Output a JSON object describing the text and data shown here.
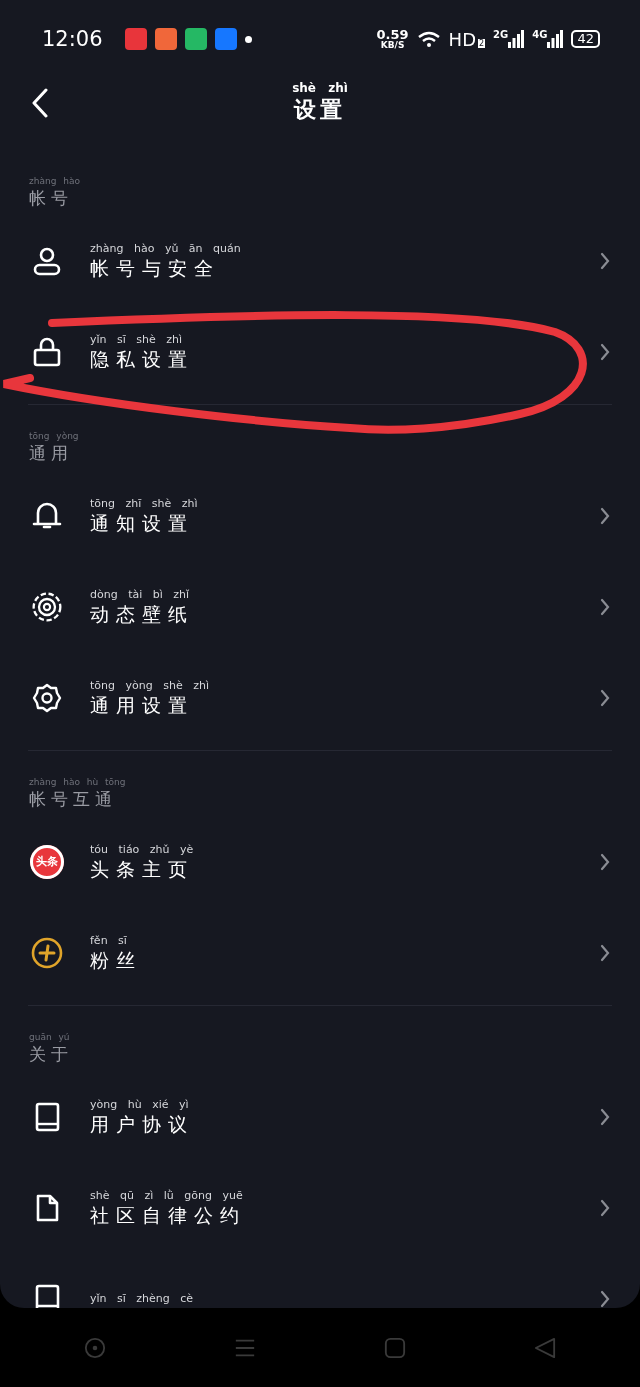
{
  "status_bar": {
    "time": "12:06",
    "speed": "0.59",
    "speed_unit": "KB/S",
    "hd": "HD",
    "hd_sub": "2",
    "signals": [
      "2G",
      "4G"
    ],
    "battery": "42"
  },
  "header": {
    "title_pinyin": "shè zhì",
    "title": "设置"
  },
  "sections": [
    {
      "pinyin": "zhàng hào",
      "title": "帐号",
      "items": [
        {
          "kind": "user",
          "pinyin": "zhàng hào yǔ ān quán",
          "label": "帐号与安全",
          "circled": false
        },
        {
          "kind": "lock",
          "pinyin": "yǐn sī shè zhì",
          "label": "隐私设置",
          "circled": true
        }
      ]
    },
    {
      "pinyin": "tōng yòng",
      "title": "通用",
      "items": [
        {
          "kind": "bell",
          "pinyin": "tōng zhī shè zhì",
          "label": "通知设置",
          "circled": false
        },
        {
          "kind": "wallpaper",
          "pinyin": "dòng tài bì zhǐ",
          "label": "动态壁纸",
          "circled": false
        },
        {
          "kind": "gear",
          "pinyin": "tōng yòng shè zhì",
          "label": "通用设置",
          "circled": false
        }
      ]
    },
    {
      "pinyin": "zhàng hào hù tōng",
      "title": "帐号互通",
      "items": [
        {
          "kind": "toutiao",
          "badge": "头条",
          "pinyin": "tóu tiáo zhǔ yè",
          "label": "头条主页",
          "circled": false
        },
        {
          "kind": "fans",
          "pinyin": "fěn sī",
          "label": "粉丝",
          "circled": false
        }
      ]
    },
    {
      "pinyin": "guān yú",
      "title": "关于",
      "items": [
        {
          "kind": "book",
          "pinyin": "yòng hù xié yì",
          "label": "用户协议",
          "circled": false
        },
        {
          "kind": "document",
          "pinyin": "shè qū zì lǜ gōng yuē",
          "label": "社区自律公约",
          "circled": false
        },
        {
          "kind": "book",
          "pinyin": "yǐn sī zhèng cè",
          "circled": false
        }
      ]
    }
  ]
}
